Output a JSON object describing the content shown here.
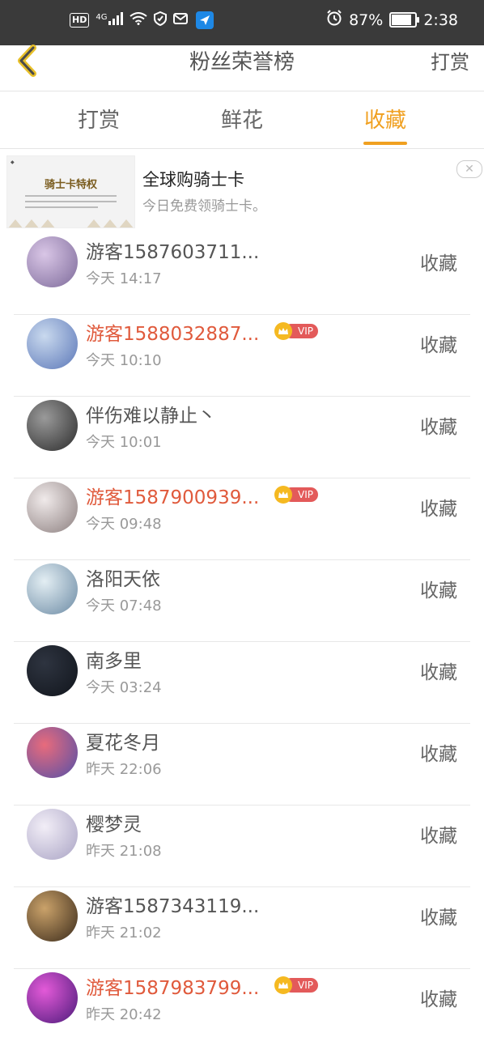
{
  "status_bar": {
    "hd": "HD",
    "network": "4G",
    "battery_pct": "87%",
    "time": "2:38",
    "icons": [
      "signal-icon",
      "wifi-icon",
      "vpn-icon",
      "mail-check-icon",
      "app-icon",
      "alarm-icon",
      "battery-icon"
    ]
  },
  "header": {
    "title": "粉丝荣誉榜",
    "action": "打赏",
    "back_icon": "chevron-left-icon"
  },
  "tabs": [
    {
      "label": "打赏",
      "active": false
    },
    {
      "label": "鲜花",
      "active": false
    },
    {
      "label": "收藏",
      "active": true
    }
  ],
  "ad": {
    "title": "全球购骑士卡",
    "subtitle": "今日免费领骑士卡。",
    "thumb_title": "骑士卡特权",
    "close_icon": "close-icon"
  },
  "list": [
    {
      "name": "游客1587603711...",
      "time": "今天 14:17",
      "vip": false,
      "action": "收藏",
      "avatar_colors": [
        "#d9c6e6",
        "#7d6a9a"
      ]
    },
    {
      "name": "游客1588032887...",
      "time": "今天 10:10",
      "vip": true,
      "vip_label": "VIP",
      "action": "收藏",
      "avatar_colors": [
        "#c9d9ee",
        "#5b77b8"
      ]
    },
    {
      "name": "伴伤难以静止丶",
      "time": "今天 10:01",
      "vip": false,
      "action": "收藏",
      "avatar_colors": [
        "#9a9a9a",
        "#2b2b2b"
      ]
    },
    {
      "name": "游客1587900939...",
      "time": "今天 09:48",
      "vip": true,
      "vip_label": "VIP",
      "action": "收藏",
      "avatar_colors": [
        "#f0eaea",
        "#8c7f7f"
      ]
    },
    {
      "name": "洛阳天依",
      "time": "今天 07:48",
      "vip": false,
      "action": "收藏",
      "avatar_colors": [
        "#e3eef3",
        "#6b8aa4"
      ]
    },
    {
      "name": "南多里",
      "time": "今天 03:24",
      "vip": false,
      "action": "收藏",
      "avatar_colors": [
        "#2e3440",
        "#11151c"
      ]
    },
    {
      "name": "夏花冬月",
      "time": "昨天 22:06",
      "vip": false,
      "action": "收藏",
      "avatar_colors": [
        "#e86b7c",
        "#5450a8"
      ]
    },
    {
      "name": "樱梦灵",
      "time": "昨天 21:08",
      "vip": false,
      "action": "收藏",
      "avatar_colors": [
        "#f2eef7",
        "#a9a3c4"
      ]
    },
    {
      "name": "游客1587343119...",
      "time": "昨天 21:02",
      "vip": false,
      "action": "收藏",
      "avatar_colors": [
        "#caa26a",
        "#3a2a1a"
      ]
    },
    {
      "name": "游客1587983799...",
      "time": "昨天 20:42",
      "vip": true,
      "vip_label": "VIP",
      "action": "收藏",
      "avatar_colors": [
        "#e35ad8",
        "#4b1a7a"
      ]
    }
  ]
}
